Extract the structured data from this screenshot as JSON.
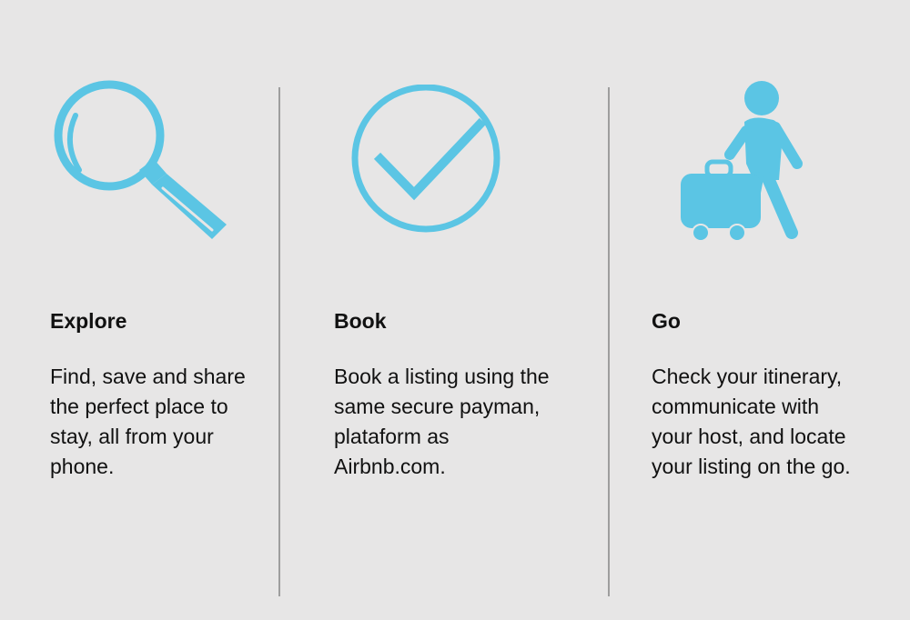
{
  "colors": {
    "background": "#e7e6e6",
    "icon_accent": "#5bc5e4",
    "divider": "#9e9e9e",
    "text": "#111111"
  },
  "features": [
    {
      "icon": "magnifying-glass-icon",
      "title": "Explore",
      "description": "Find, save and share\nthe perfect place to\nstay, all from your\nphone."
    },
    {
      "icon": "checkmark-circle-icon",
      "title": "Book",
      "description": "Book a listing using the\nsame secure payman,\nplataform as\nAirbnb.com."
    },
    {
      "icon": "traveler-with-luggage-icon",
      "title": "Go",
      "description": "Check your itinerary,\ncommunicate  with\nyour host, and locate\nyour listing on the go."
    }
  ]
}
